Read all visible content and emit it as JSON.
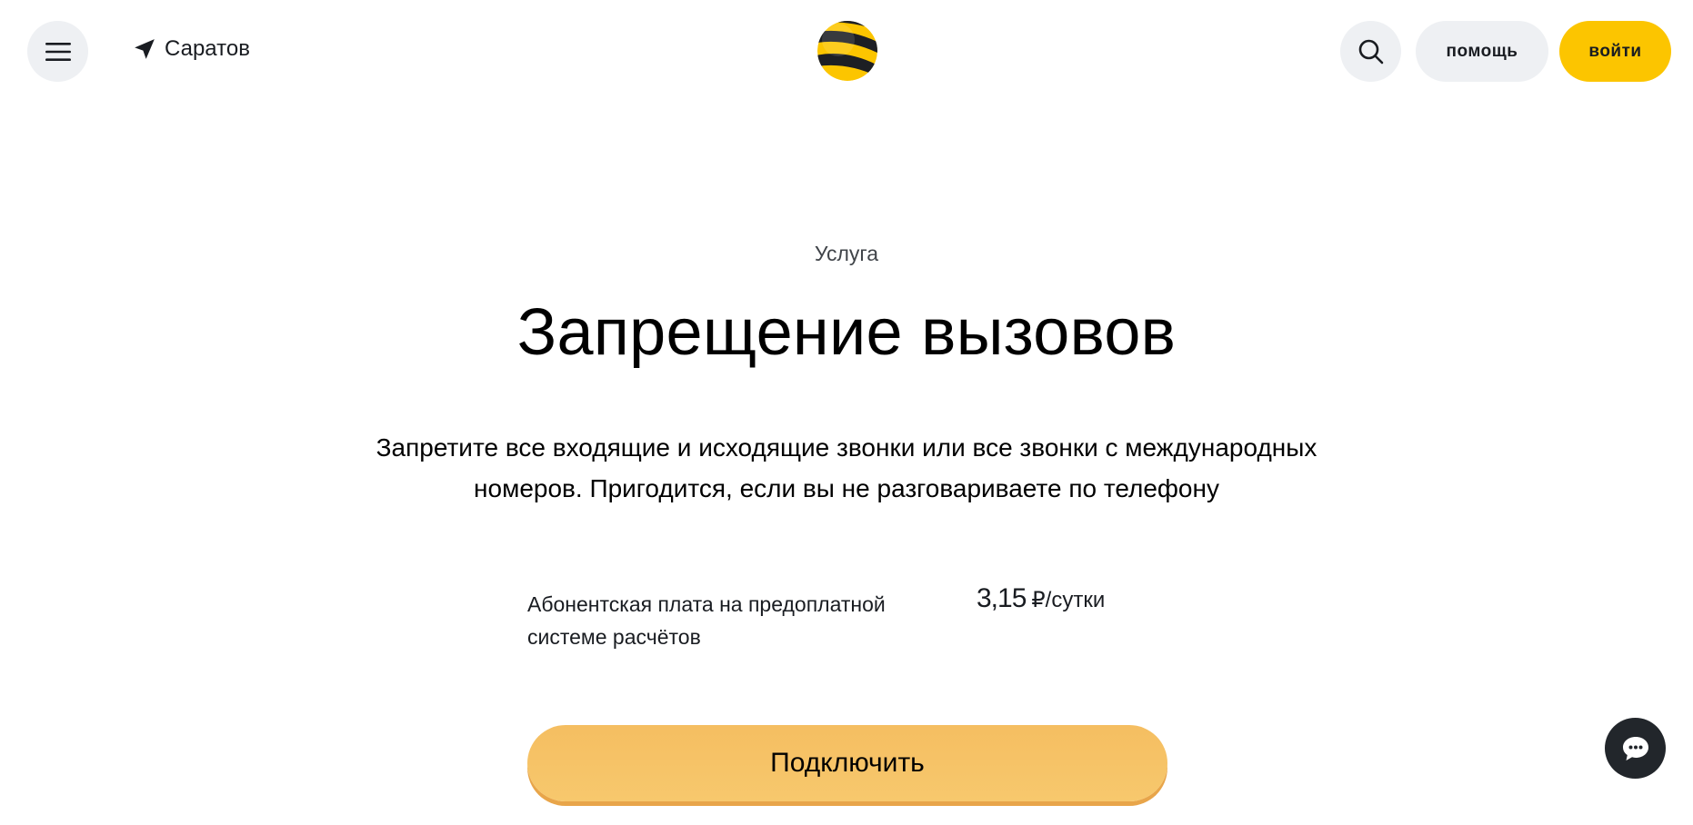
{
  "header": {
    "city": "Саратов",
    "help_label": "помощь",
    "login_label": "войти",
    "logo_icon": "beeline-logo",
    "menu_icon": "hamburger-icon",
    "location_icon": "location-arrow-icon",
    "search_icon": "search-icon"
  },
  "service": {
    "eyebrow": "Услуга",
    "title": "Запрещение вызовов",
    "description": "Запретите все входящие и исходящие звонки или все звонки с международных номеров. Пригодится, если вы не разговариваете по телефону",
    "fee_label": "Абонентская плата на предоплатной системе расчётов",
    "fee_amount": "3,15",
    "fee_unit": "₽/сутки",
    "connect_label": "Подключить"
  },
  "chat": {
    "icon": "chat-bubble-icon"
  },
  "colors": {
    "brand_yellow": "#fcc500",
    "button_orange": "#f5be61",
    "dark": "#191c21",
    "light_gray": "#eef0f3"
  }
}
